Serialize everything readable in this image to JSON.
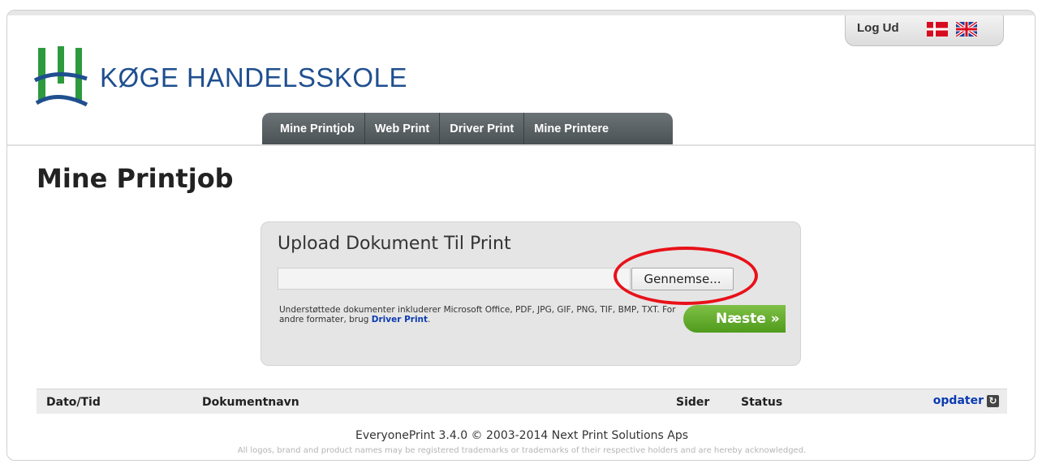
{
  "header": {
    "logout_label": "Log Ud",
    "school_name": "KØGE HANDELSSKOLE",
    "languages": [
      "Danish",
      "English"
    ]
  },
  "nav": {
    "items": [
      {
        "label": "Mine Printjob"
      },
      {
        "label": "Web Print"
      },
      {
        "label": "Driver Print"
      },
      {
        "label": "Mine Printere"
      }
    ]
  },
  "page": {
    "title": "Mine Printjob"
  },
  "upload": {
    "title": "Upload Dokument Til Print",
    "file_value": "",
    "browse_label": "Gennemse...",
    "supported_text": "Understøttede dokumenter inkluderer Microsoft Office, PDF, JPG, GIF, PNG, TIF, BMP, TXT. For andre formater, brug",
    "driver_link": "Driver Print",
    "supported_end": ".",
    "next_label": "Næste »"
  },
  "table": {
    "columns": {
      "date": "Dato/Tid",
      "document": "Dokumentnavn",
      "pages": "Sider",
      "status": "Status"
    },
    "refresh_label": "opdater"
  },
  "footer": {
    "main": "EveryonePrint 3.4.0 © 2003-2014 Next Print Solutions Aps",
    "sub": "All logos, brand and product names may be registered trademarks or trademarks of their respective holders and are hereby acknowledged."
  },
  "colors": {
    "brand_blue": "#1f4f8f",
    "nav_bg": "#55595c",
    "next_green": "#5aa823",
    "highlight_red": "#e8111a",
    "link_blue": "#0b3bb0"
  }
}
